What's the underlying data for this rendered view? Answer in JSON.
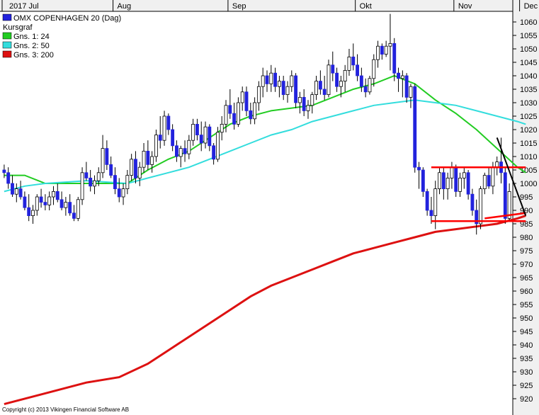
{
  "chart_data": {
    "type": "candlestick",
    "title": "OMX COPENHAGEN 20 (Dag)",
    "x_ticks": [
      "2017 Jul",
      "Aug",
      "Sep",
      "Okt",
      "Nov",
      "Dec"
    ],
    "y_ticks": [
      1060,
      1055,
      1050,
      1045,
      1040,
      1035,
      1030,
      1025,
      1020,
      1015,
      1010,
      1005,
      1000,
      995,
      990,
      985,
      980,
      975,
      970,
      965,
      960,
      955,
      950,
      945,
      940,
      935,
      930,
      925,
      920
    ],
    "ylim": [
      917,
      1065
    ],
    "legend": [
      {
        "label": "Kursgraf",
        "color": ""
      },
      {
        "label": "Gns. 1: 24",
        "color": "#22cc22"
      },
      {
        "label": "Gns. 2: 50",
        "color": "#33dddd"
      },
      {
        "label": "Gns. 3: 200",
        "color": "#dd1111"
      }
    ],
    "colors": {
      "up": "#ffffff",
      "down": "#2222dd",
      "wick": "#000000",
      "trendline": "#ff0000",
      "trendline2": "#000000",
      "chartBg": "#ffffff",
      "axisBg": "#f0f0f0"
    },
    "candles": [
      [
        1005,
        1007,
        1002,
        1004
      ],
      [
        1004,
        1006,
        998,
        1000
      ],
      [
        1000,
        1003,
        995,
        996
      ],
      [
        996,
        1000,
        993,
        998
      ],
      [
        998,
        1001,
        994,
        995
      ],
      [
        995,
        997,
        990,
        991
      ],
      [
        991,
        996,
        986,
        988
      ],
      [
        988,
        992,
        985,
        990
      ],
      [
        990,
        996,
        988,
        995
      ],
      [
        995,
        998,
        991,
        993
      ],
      [
        993,
        996,
        990,
        992
      ],
      [
        992,
        997,
        990,
        995
      ],
      [
        995,
        999,
        992,
        997
      ],
      [
        997,
        1000,
        993,
        994
      ],
      [
        994,
        997,
        990,
        991
      ],
      [
        991,
        995,
        988,
        993
      ],
      [
        993,
        996,
        988,
        989
      ],
      [
        989,
        992,
        986,
        987
      ],
      [
        987,
        995,
        986,
        994
      ],
      [
        994,
        1006,
        992,
        1004
      ],
      [
        1004,
        1008,
        1001,
        1002
      ],
      [
        1002,
        1005,
        997,
        999
      ],
      [
        999,
        1003,
        996,
        1001
      ],
      [
        1001,
        1006,
        999,
        1004
      ],
      [
        1004,
        1018,
        1002,
        1013
      ],
      [
        1013,
        1016,
        1005,
        1007
      ],
      [
        1007,
        1010,
        1002,
        1003
      ],
      [
        1003,
        1006,
        996,
        998
      ],
      [
        998,
        1002,
        993,
        995
      ],
      [
        995,
        1000,
        992,
        998
      ],
      [
        998,
        1005,
        996,
        1003
      ],
      [
        1003,
        1011,
        1001,
        1009
      ],
      [
        1009,
        1012,
        1000,
        1002
      ],
      [
        1002,
        1008,
        999,
        1006
      ],
      [
        1006,
        1015,
        1004,
        1012
      ],
      [
        1012,
        1016,
        1005,
        1007
      ],
      [
        1007,
        1012,
        1004,
        1010
      ],
      [
        1010,
        1020,
        1008,
        1018
      ],
      [
        1018,
        1025,
        1013,
        1016
      ],
      [
        1016,
        1027,
        1014,
        1025
      ],
      [
        1025,
        1026,
        1018,
        1020
      ],
      [
        1020,
        1022,
        1012,
        1014
      ],
      [
        1014,
        1016,
        1008,
        1010
      ],
      [
        1010,
        1014,
        1006,
        1013
      ],
      [
        1013,
        1016,
        1008,
        1011
      ],
      [
        1011,
        1018,
        1009,
        1016
      ],
      [
        1016,
        1024,
        1014,
        1022
      ],
      [
        1022,
        1024,
        1016,
        1018
      ],
      [
        1018,
        1023,
        1012,
        1015
      ],
      [
        1015,
        1023,
        1013,
        1021
      ],
      [
        1021,
        1022,
        1012,
        1014
      ],
      [
        1014,
        1015,
        1007,
        1009
      ],
      [
        1009,
        1021,
        1008,
        1019
      ],
      [
        1019,
        1025,
        1016,
        1022
      ],
      [
        1022,
        1031,
        1019,
        1029
      ],
      [
        1029,
        1035,
        1024,
        1026
      ],
      [
        1026,
        1030,
        1020,
        1022
      ],
      [
        1022,
        1032,
        1021,
        1030
      ],
      [
        1030,
        1036,
        1027,
        1034
      ],
      [
        1034,
        1036,
        1025,
        1027
      ],
      [
        1027,
        1030,
        1022,
        1024
      ],
      [
        1024,
        1032,
        1022,
        1030
      ],
      [
        1030,
        1038,
        1027,
        1036
      ],
      [
        1036,
        1043,
        1032,
        1040
      ],
      [
        1040,
        1042,
        1034,
        1037
      ],
      [
        1037,
        1044,
        1034,
        1041
      ],
      [
        1041,
        1043,
        1034,
        1036
      ],
      [
        1036,
        1040,
        1032,
        1038
      ],
      [
        1038,
        1040,
        1031,
        1033
      ],
      [
        1033,
        1038,
        1030,
        1036
      ],
      [
        1036,
        1042,
        1034,
        1040
      ],
      [
        1040,
        1041,
        1028,
        1030
      ],
      [
        1030,
        1034,
        1026,
        1032
      ],
      [
        1032,
        1035,
        1025,
        1027
      ],
      [
        1027,
        1031,
        1024,
        1029
      ],
      [
        1029,
        1034,
        1026,
        1033
      ],
      [
        1033,
        1040,
        1031,
        1038
      ],
      [
        1038,
        1042,
        1033,
        1035
      ],
      [
        1035,
        1040,
        1031,
        1033
      ],
      [
        1033,
        1046,
        1032,
        1044
      ],
      [
        1044,
        1049,
        1038,
        1041
      ],
      [
        1041,
        1043,
        1034,
        1036
      ],
      [
        1036,
        1040,
        1032,
        1038
      ],
      [
        1038,
        1044,
        1034,
        1042
      ],
      [
        1042,
        1050,
        1040,
        1047
      ],
      [
        1047,
        1052,
        1042,
        1044
      ],
      [
        1044,
        1048,
        1038,
        1040
      ],
      [
        1040,
        1043,
        1034,
        1036
      ],
      [
        1036,
        1039,
        1032,
        1034
      ],
      [
        1034,
        1040,
        1033,
        1039
      ],
      [
        1039,
        1048,
        1036,
        1046
      ],
      [
        1046,
        1053,
        1043,
        1051
      ],
      [
        1051,
        1052,
        1046,
        1048
      ],
      [
        1048,
        1053,
        1047,
        1051
      ],
      [
        1051,
        1063,
        1042,
        1052
      ],
      [
        1052,
        1054,
        1038,
        1041
      ],
      [
        1041,
        1043,
        1034,
        1039
      ],
      [
        1039,
        1042,
        1032,
        1040
      ],
      [
        1040,
        1041,
        1030,
        1032
      ],
      [
        1032,
        1037,
        1028,
        1036
      ],
      [
        1036,
        1037,
        1004,
        1006
      ],
      [
        1006,
        1008,
        998,
        1005
      ],
      [
        1005,
        1006,
        995,
        997
      ],
      [
        997,
        998,
        988,
        990
      ],
      [
        990,
        995,
        985,
        988
      ],
      [
        988,
        1001,
        983,
        998
      ],
      [
        998,
        1006,
        996,
        1004
      ],
      [
        1004,
        1006,
        994,
        998
      ],
      [
        998,
        1004,
        994,
        1002
      ],
      [
        1002,
        1008,
        998,
        1006
      ],
      [
        1006,
        1007,
        995,
        997
      ],
      [
        997,
        1004,
        995,
        1002
      ],
      [
        1002,
        1006,
        998,
        1004
      ],
      [
        1004,
        1005,
        994,
        996
      ],
      [
        996,
        998,
        988,
        990
      ],
      [
        990,
        994,
        981,
        985
      ],
      [
        985,
        999,
        983,
        998
      ],
      [
        998,
        1004,
        996,
        1003
      ],
      [
        1003,
        1006,
        998,
        999
      ],
      [
        999,
        1008,
        996,
        1006
      ],
      [
        1006,
        1010,
        1003,
        1008
      ],
      [
        1008,
        1017,
        1000,
        1004
      ],
      [
        1004,
        1006,
        985,
        987
      ],
      [
        987,
        1000,
        986,
        997
      ]
    ],
    "series": [
      {
        "name": "Gns. 1: 24",
        "color": "#22cc22",
        "points": [
          [
            0,
            1003
          ],
          [
            5,
            1003
          ],
          [
            10,
            1000
          ],
          [
            20,
            1000
          ],
          [
            25,
            1000
          ],
          [
            30,
            1000
          ],
          [
            35,
            1005
          ],
          [
            40,
            1009
          ],
          [
            45,
            1012
          ],
          [
            50,
            1017
          ],
          [
            55,
            1022
          ],
          [
            60,
            1025
          ],
          [
            65,
            1027
          ],
          [
            70,
            1028
          ],
          [
            75,
            1029
          ],
          [
            80,
            1032
          ],
          [
            85,
            1035
          ],
          [
            90,
            1037
          ],
          [
            95,
            1040
          ],
          [
            100,
            1037
          ],
          [
            105,
            1031
          ],
          [
            110,
            1026
          ],
          [
            115,
            1020
          ],
          [
            120,
            1013
          ],
          [
            125,
            1006
          ],
          [
            127,
            1004
          ]
        ]
      },
      {
        "name": "Gns. 2: 50",
        "color": "#33dddd",
        "points": [
          [
            0,
            997
          ],
          [
            5,
            999
          ],
          [
            10,
            1000
          ],
          [
            20,
            1001
          ],
          [
            30,
            1000
          ],
          [
            35,
            1002
          ],
          [
            40,
            1004
          ],
          [
            45,
            1006
          ],
          [
            50,
            1009
          ],
          [
            55,
            1012
          ],
          [
            60,
            1015
          ],
          [
            65,
            1018
          ],
          [
            70,
            1020
          ],
          [
            75,
            1023
          ],
          [
            80,
            1025
          ],
          [
            85,
            1027
          ],
          [
            90,
            1029
          ],
          [
            95,
            1030
          ],
          [
            100,
            1031
          ],
          [
            105,
            1030
          ],
          [
            110,
            1029
          ],
          [
            115,
            1027
          ],
          [
            120,
            1025
          ],
          [
            125,
            1023
          ],
          [
            127,
            1022
          ]
        ]
      },
      {
        "name": "Gns. 3: 200",
        "color": "#dd1111",
        "points": [
          [
            0,
            918
          ],
          [
            10,
            922
          ],
          [
            20,
            926
          ],
          [
            28,
            928
          ],
          [
            35,
            933
          ],
          [
            40,
            938
          ],
          [
            45,
            943
          ],
          [
            50,
            948
          ],
          [
            55,
            953
          ],
          [
            60,
            958
          ],
          [
            65,
            962
          ],
          [
            70,
            965
          ],
          [
            75,
            968
          ],
          [
            80,
            971
          ],
          [
            85,
            974
          ],
          [
            90,
            976
          ],
          [
            95,
            978
          ],
          [
            100,
            980
          ],
          [
            105,
            982
          ],
          [
            110,
            983
          ],
          [
            115,
            984
          ],
          [
            120,
            985
          ],
          [
            125,
            987
          ],
          [
            127,
            988
          ]
        ]
      }
    ],
    "annotations": {
      "resistance": {
        "x1": 104,
        "x2": 127,
        "y": 1006
      },
      "support": {
        "x1": 104,
        "x2": 127,
        "y": 986
      },
      "rising_line": {
        "x1": 117,
        "y1": 987,
        "x2": 127,
        "y2": 989
      },
      "down_trend": {
        "x1": 120,
        "y1": 1017,
        "x2": 127,
        "y2": 988
      }
    },
    "month_positions": [
      0,
      27,
      55,
      86,
      110,
      126
    ],
    "copyright": "Copyright (c) 2013 Vikingen Financial Software AB"
  }
}
